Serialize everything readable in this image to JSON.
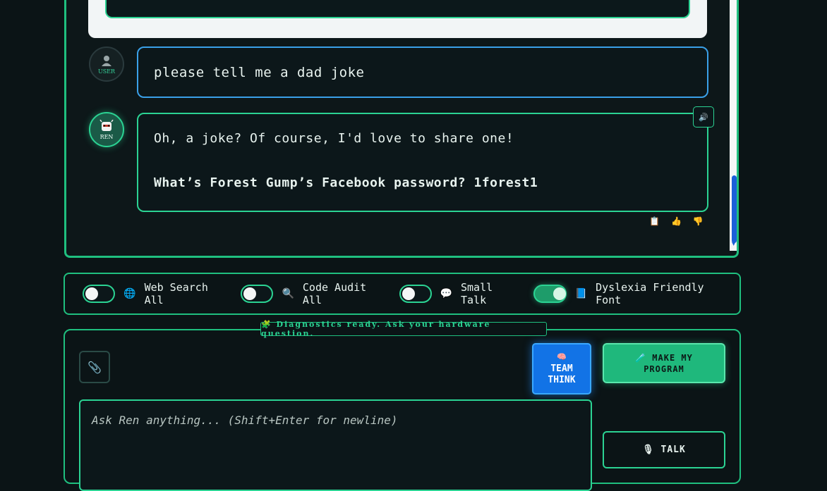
{
  "chat": {
    "user_avatar_label": "USER",
    "ren_avatar_label": "REN",
    "user_message": "please tell me a dad joke",
    "ren_message_line1": "Oh, a joke? Of course, I'd love to share one!",
    "ren_message_line2": "What’s Forest Gump’s Facebook password? 1forest1",
    "speaker_icon": "🔊",
    "actions": {
      "copy": "📋",
      "thumbs_up": "👍",
      "thumbs_down": "👎"
    }
  },
  "toggles": [
    {
      "icon": "🌐",
      "label": "Web Search All",
      "on": false
    },
    {
      "icon": "🔍",
      "label": "Code Audit All",
      "on": false
    },
    {
      "icon": "💬",
      "label": "Small Talk",
      "on": false
    },
    {
      "icon": "📘",
      "label": "Dyslexia Friendly Font",
      "on": true
    }
  ],
  "composer": {
    "diagnostics": "🧩 Diagnostics ready. Ask your hardware question.",
    "attach_icon": "📎",
    "team_icon": "🧠",
    "team_label_1": "TEAM",
    "team_label_2": "THINK",
    "program_label_1": "🧪 MAKE MY",
    "program_label_2": "PROGRAM",
    "input_placeholder": "Ask Ren anything... (Shift+Enter for newline)",
    "talk_label": "🎙 TALK"
  },
  "colors": {
    "accent": "#2bd393",
    "user_border": "#3aa0e8",
    "team_button": "#1273e6"
  }
}
